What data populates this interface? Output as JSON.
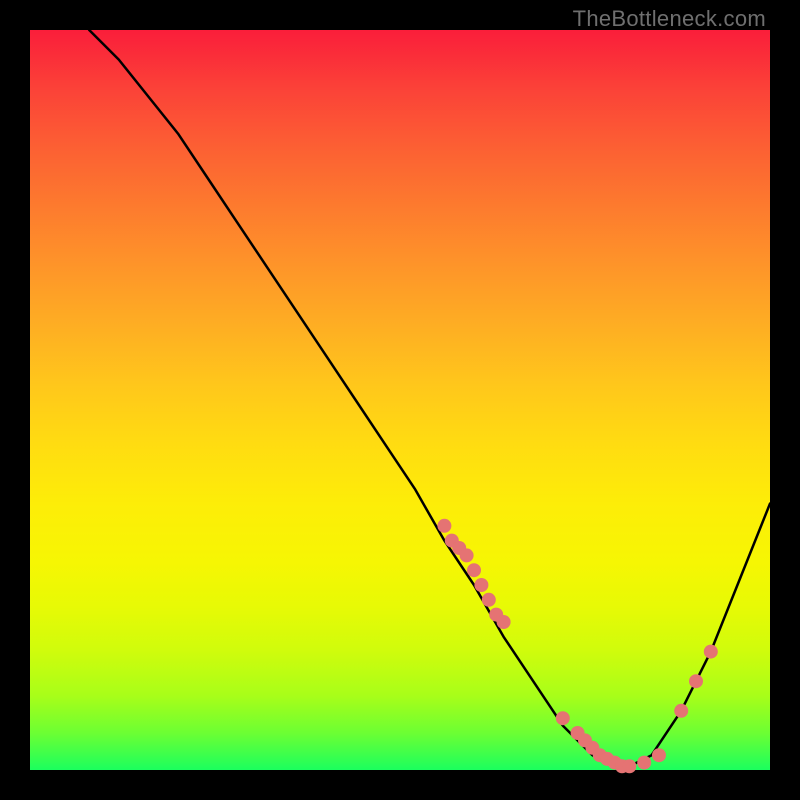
{
  "watermark": "TheBottleneck.com",
  "chart_data": {
    "type": "line",
    "title": "",
    "xlabel": "",
    "ylabel": "",
    "xlim": [
      0,
      100
    ],
    "ylim": [
      0,
      100
    ],
    "grid": false,
    "legend": false,
    "series": [
      {
        "name": "curve",
        "style": "line",
        "color": "#000000",
        "x": [
          8,
          12,
          16,
          20,
          24,
          28,
          32,
          36,
          40,
          44,
          48,
          52,
          56,
          60,
          64,
          68,
          72,
          76,
          80,
          84,
          88,
          92,
          96,
          100
        ],
        "y": [
          100,
          96,
          91,
          86,
          80,
          74,
          68,
          62,
          56,
          50,
          44,
          38,
          31,
          25,
          18,
          12,
          6,
          2,
          0,
          2,
          8,
          16,
          26,
          36
        ]
      },
      {
        "name": "markers",
        "style": "scatter",
        "color": "#e57373",
        "x": [
          56,
          57,
          58,
          59,
          60,
          61,
          62,
          63,
          64,
          72,
          74,
          75,
          76,
          77,
          78,
          79,
          80,
          81,
          83,
          85,
          88,
          90,
          92
        ],
        "y": [
          33,
          31,
          30,
          29,
          27,
          25,
          23,
          21,
          20,
          7,
          5,
          4,
          3,
          2,
          1.5,
          1,
          0.5,
          0.5,
          1,
          2,
          8,
          12,
          16
        ]
      }
    ]
  },
  "colors": {
    "curve": "#000000",
    "marker_fill": "#e57373",
    "marker_stroke": "#c84f4f",
    "background_frame": "#000000"
  }
}
